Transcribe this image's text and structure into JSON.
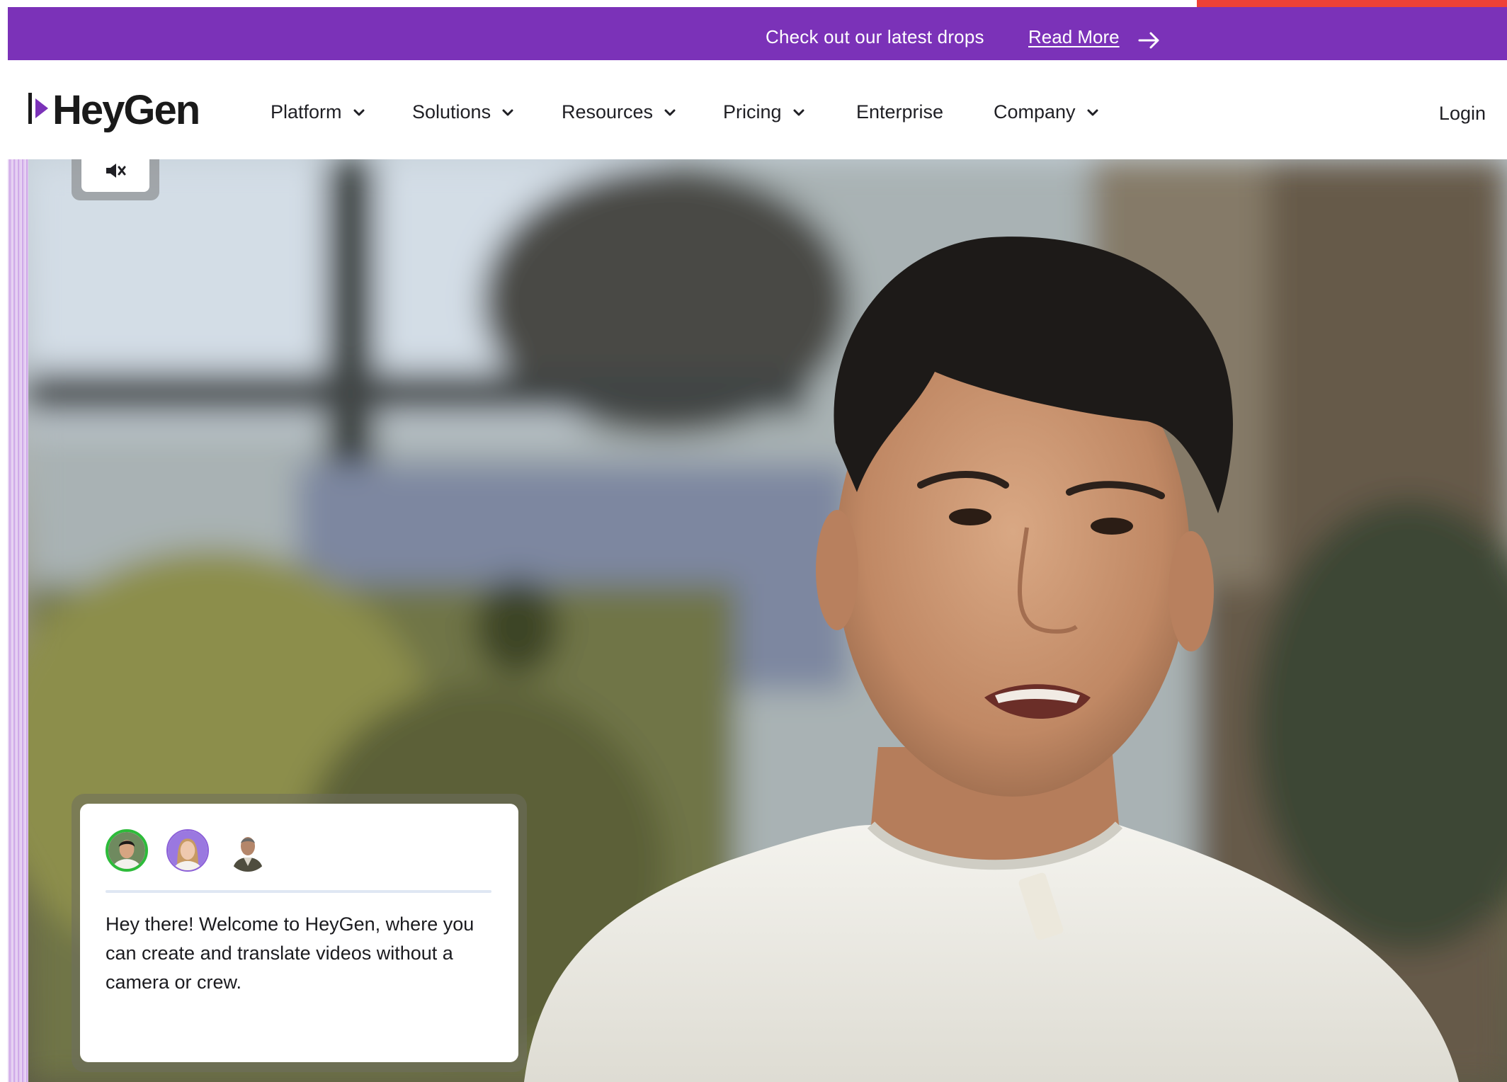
{
  "banner": {
    "text": "Check out our latest drops",
    "link_label": "Read More"
  },
  "nav": {
    "logo_text": "HeyGen",
    "items": [
      {
        "label": "Platform",
        "has_dropdown": true
      },
      {
        "label": "Solutions",
        "has_dropdown": true
      },
      {
        "label": "Resources",
        "has_dropdown": true
      },
      {
        "label": "Pricing",
        "has_dropdown": true
      },
      {
        "label": "Enterprise",
        "has_dropdown": false
      },
      {
        "label": "Company",
        "has_dropdown": true
      }
    ],
    "login_label": "Login"
  },
  "hero": {
    "mute_icon": "speaker-muted-icon",
    "chat": {
      "avatars": [
        "avatar-man-asian",
        "avatar-woman",
        "avatar-man-older"
      ],
      "active_avatar_index": 0,
      "message": "Hey there! Welcome to HeyGen, where you can create and translate videos without a camera or crew."
    }
  },
  "colors": {
    "banner_bg": "#7b32b8",
    "accent_strip": "#ef4136",
    "active_avatar_ring": "#2dbb3a",
    "avatar_ring_purple": "#8b5fd8",
    "text_dark": "#1f1f24"
  }
}
